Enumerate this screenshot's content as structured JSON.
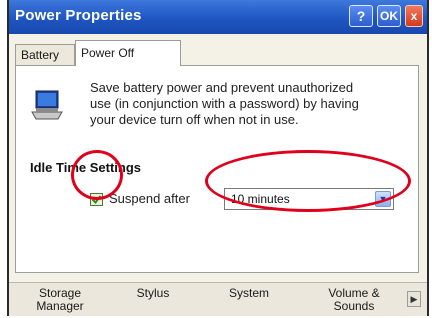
{
  "window": {
    "title": "Power Properties",
    "buttons": {
      "help": "?",
      "ok": "OK",
      "close": "x"
    }
  },
  "tabs": [
    {
      "label": "Battery",
      "active": false
    },
    {
      "label": "Power Off",
      "active": true
    }
  ],
  "panel": {
    "description_lines": [
      "Save battery power and prevent unauthorized",
      "use (in conjunction with a password) by having",
      "your device turn off when not in use."
    ],
    "section_title": "Idle Time Settings",
    "suspend": {
      "label": "Suspend after",
      "checked": true,
      "selected": "10 minutes"
    }
  },
  "bottom_nav": {
    "items": [
      {
        "line1": "Storage",
        "line2": "Manager"
      },
      {
        "line1": "Stylus",
        "line2": ""
      },
      {
        "line1": "System",
        "line2": ""
      },
      {
        "line1": "Volume &",
        "line2": "Sounds"
      }
    ]
  },
  "colors": {
    "titlebar": "#1f56c2",
    "annotation": "#e0001b",
    "panel_bg": "#f4f1e6"
  },
  "icons": [
    "laptop-icon",
    "help-icon",
    "ok-icon",
    "close-icon",
    "checkmark-icon",
    "chevron-down-icon",
    "scroll-right-icon"
  ]
}
